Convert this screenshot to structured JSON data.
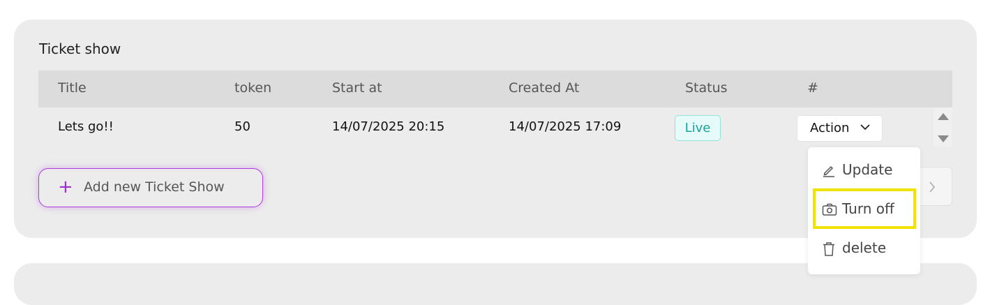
{
  "card": {
    "title": "Ticket show"
  },
  "table": {
    "columns": [
      "Title",
      "token",
      "Start at",
      "Created At",
      "Status",
      "#"
    ],
    "rows": [
      {
        "title": "Lets go!!",
        "token": "50",
        "start_at": "14/07/2025 20:15",
        "created_at": "14/07/2025 17:09",
        "status": "Live",
        "action_label": "Action"
      }
    ]
  },
  "add_button": {
    "label": "Add new Ticket Show"
  },
  "action_menu": {
    "items": [
      {
        "label": "Update",
        "icon": "pencil-icon"
      },
      {
        "label": "Turn off",
        "icon": "camera-icon"
      },
      {
        "label": "delete",
        "icon": "trash-icon"
      }
    ],
    "highlighted_item": "Turn off"
  },
  "colors": {
    "accent": "#b03bde",
    "status_live": "#1ba39a",
    "highlight": "#f2e200"
  }
}
